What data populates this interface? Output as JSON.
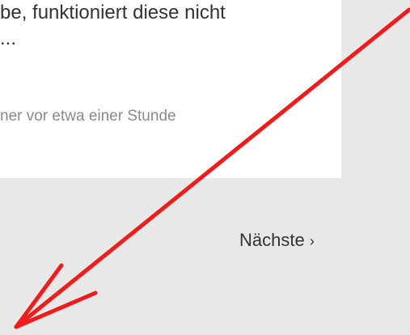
{
  "card": {
    "text_lines": [
      "be, funktioniert diese nicht",
      "..."
    ],
    "meta": "ner vor etwa einer Stunde"
  },
  "pagination": {
    "next_label": "Nächste",
    "next_chevron": "›"
  },
  "annotation": {
    "arrow_color": "#ee1c1c",
    "icon": "arrow-down-left-icon"
  }
}
